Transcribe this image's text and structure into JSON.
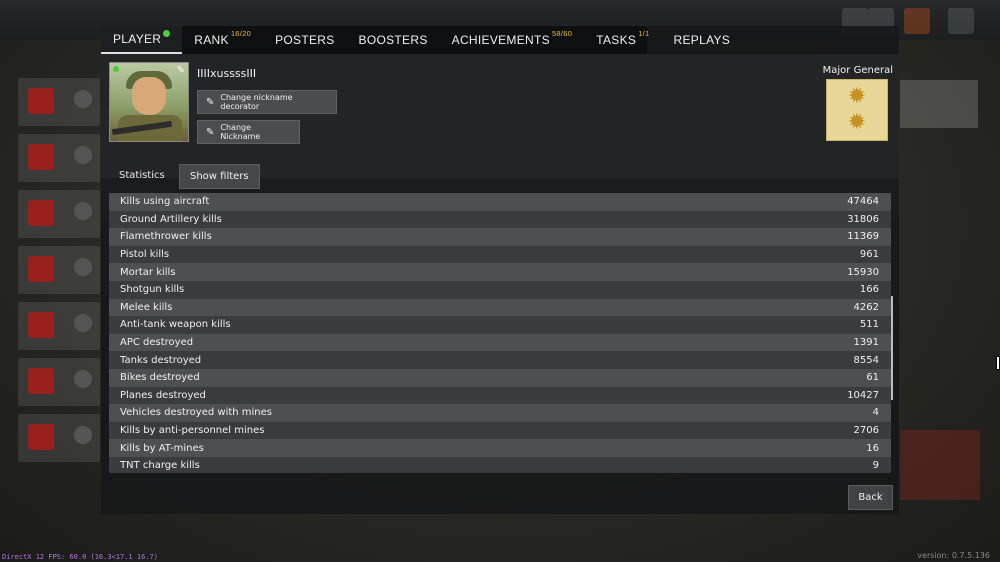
{
  "tabs": [
    {
      "label": "PLAYER",
      "sup": ""
    },
    {
      "label": "RANK",
      "sup": "16/20"
    },
    {
      "label": "POSTERS",
      "sup": ""
    },
    {
      "label": "BOOSTERS",
      "sup": ""
    },
    {
      "label": "ACHIEVEMENTS",
      "sup": "58/60"
    },
    {
      "label": "TASKS",
      "sup": "1/1"
    },
    {
      "label": "REPLAYS",
      "sup": ""
    }
  ],
  "profile": {
    "nickname": "IIIIxussssIII",
    "change_decorator_label": "Change nickname decorator",
    "change_nickname_label": "Change Nickname",
    "rank_title": "Major General"
  },
  "statistics": {
    "label": "Statistics",
    "filters_label": "Show filters",
    "rows": [
      {
        "name": "Kills using aircraft",
        "value": "47464"
      },
      {
        "name": "Ground Artillery kills",
        "value": "31806"
      },
      {
        "name": "Flamethrower kills",
        "value": "11369"
      },
      {
        "name": "Pistol kills",
        "value": "961"
      },
      {
        "name": "Mortar kills",
        "value": "15930"
      },
      {
        "name": "Shotgun kills",
        "value": "166"
      },
      {
        "name": "Melee kills",
        "value": "4262"
      },
      {
        "name": "Anti-tank weapon kills",
        "value": "511"
      },
      {
        "name": "APC destroyed",
        "value": "1391"
      },
      {
        "name": "Tanks destroyed",
        "value": "8554"
      },
      {
        "name": "Bikes destroyed",
        "value": "61"
      },
      {
        "name": "Planes destroyed",
        "value": "10427"
      },
      {
        "name": "Vehicles destroyed with mines",
        "value": "4"
      },
      {
        "name": "Kills by anti-personnel mines",
        "value": "2706"
      },
      {
        "name": "Kills by AT-mines",
        "value": "16"
      },
      {
        "name": "TNT charge kills",
        "value": "9"
      }
    ]
  },
  "back_label": "Back",
  "footer": {
    "fps": "DirectX 12 FPS: 60.0 (16.3<17.1 16.7)",
    "version": "version: 0.7.5.136"
  }
}
